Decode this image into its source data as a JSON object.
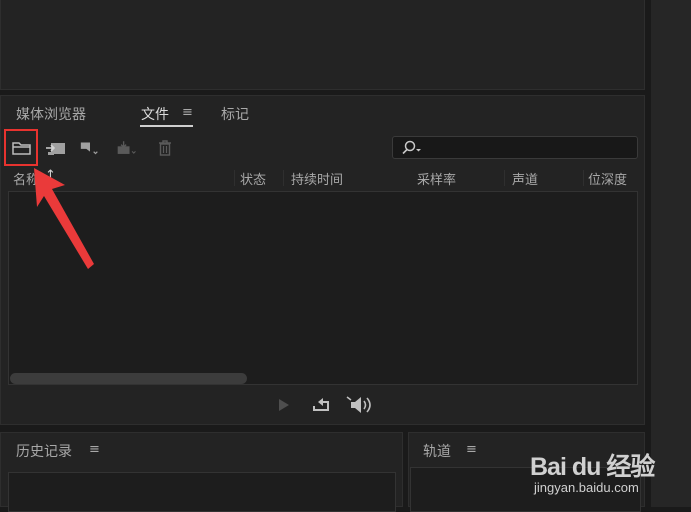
{
  "media_panel": {
    "tabs": [
      {
        "label": "媒体浏览器",
        "active": false
      },
      {
        "label": "文件",
        "active": true
      },
      {
        "label": "标记",
        "active": false
      }
    ],
    "toolbar_icons": [
      "open-folder-icon",
      "import-icon",
      "new-item-icon",
      "export-icon",
      "trash-icon"
    ],
    "search_icon": "search-icon",
    "columns": [
      "名称",
      "状态",
      "持续时间",
      "采样率",
      "声道",
      "位深度"
    ],
    "sort_indicator": "↑",
    "transport_icons": [
      "play-icon",
      "loop-icon",
      "speaker-icon"
    ]
  },
  "history_panel": {
    "title": "历史记录"
  },
  "track_panel": {
    "title": "轨道"
  },
  "watermark": {
    "brand": "Bai du 经验",
    "url": "jingyan.baidu.com"
  },
  "colors": {
    "background": "#1a1a1a",
    "panel": "#232323",
    "text": "#a8a8a8",
    "highlight": "#e8332f"
  }
}
